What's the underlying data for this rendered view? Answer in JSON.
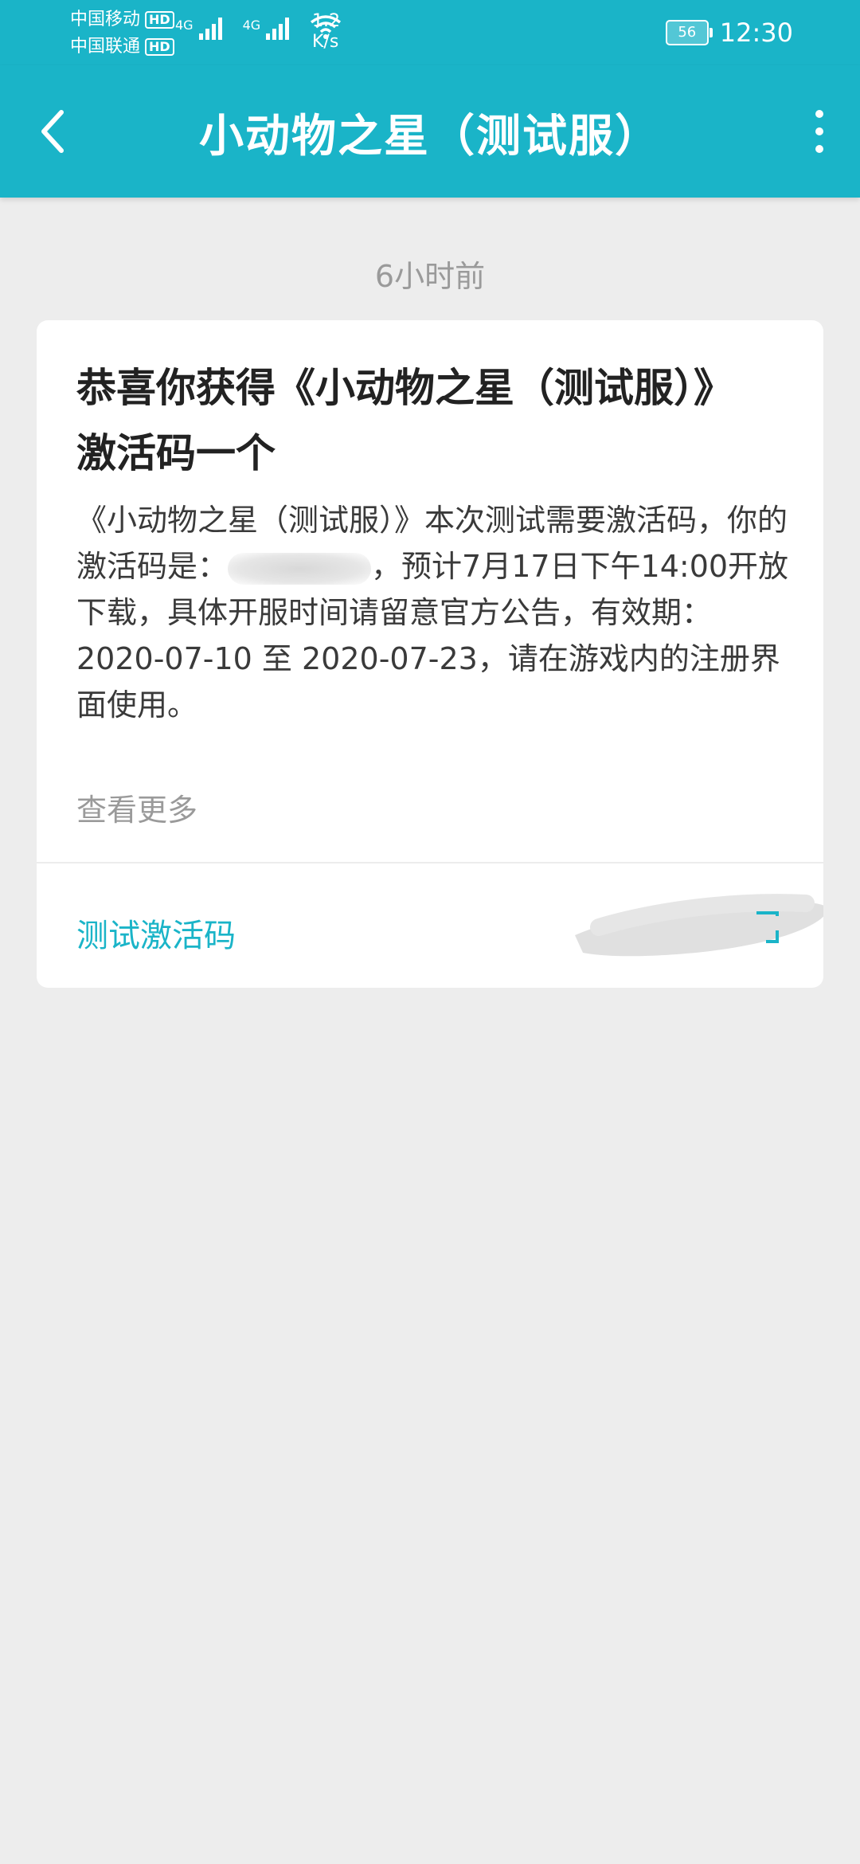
{
  "status_bar": {
    "carrier1": "中国移动",
    "carrier2": "中国联通",
    "hd": "HD",
    "net1": "4G",
    "net2": "4G",
    "speed_value": "1.2",
    "speed_unit": "K/s",
    "battery": "56",
    "time": "12:30"
  },
  "app_bar": {
    "title": "小动物之星（测试服）"
  },
  "message": {
    "timestamp": "6小时前",
    "title": "恭喜你获得《小动物之星（测试服）》激活码一个",
    "body_part1": "《小动物之星（测试服）》本次测试需要激活码，你的激活码是：",
    "body_part2": "，预计7月17日下午14:00开放下载，具体开服时间请留意官方公告，有效期：2020-07-10 至 2020-07-23，请在游戏内的注册界面使用。",
    "view_more": "查看更多",
    "footer_label": "测试激活码"
  },
  "colors": {
    "accent": "#1ab4c8",
    "background": "#ededed",
    "card": "#ffffff"
  }
}
